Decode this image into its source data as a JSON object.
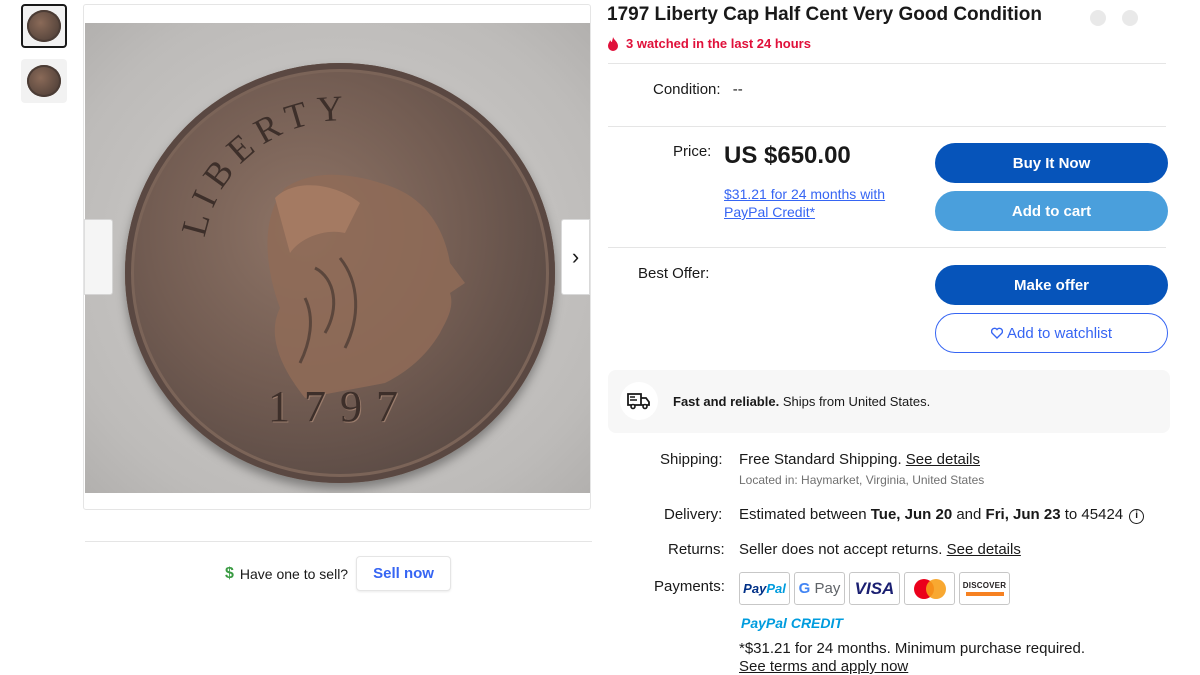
{
  "gallery": {
    "thumbnails": [
      "thumbnail-1",
      "thumbnail-2"
    ],
    "coin_legend": "LIBERTY",
    "coin_year": "1797",
    "prev_arrow": "chevron-left-icon",
    "next_arrow": "›"
  },
  "sell": {
    "prompt": "Have one to sell?",
    "button": "Sell now"
  },
  "listing": {
    "title": "1797 Liberty Cap Half Cent Very Good Condition",
    "watch_text": "3 watched in the last 24 hours",
    "condition_label": "Condition:",
    "condition_value": "--",
    "price_label": "Price:",
    "price_value": "US $650.00",
    "credit_offer": "$31.21 for 24 months with PayPal Credit*",
    "buy_now": "Buy It Now",
    "add_to_cart": "Add to cart",
    "best_offer_label": "Best Offer:",
    "make_offer": "Make offer",
    "add_to_watchlist": "Add to watchlist"
  },
  "shipping_banner": {
    "bold": "Fast and reliable.",
    "rest": " Ships from United States."
  },
  "details": {
    "shipping_label": "Shipping:",
    "shipping_value": "Free Standard Shipping.",
    "shipping_link": "See details",
    "location": "Located in: Haymarket, Virginia, United States",
    "delivery_label": "Delivery:",
    "delivery_pre": "Estimated between",
    "delivery_start": "Tue, Jun 20",
    "delivery_and": "and",
    "delivery_end": "Fri, Jun 23",
    "delivery_zip": "to 45424",
    "returns_label": "Returns:",
    "returns_value": "Seller does not accept returns.",
    "returns_link": "See details",
    "payments_label": "Payments:",
    "payment_methods": [
      "PayPal",
      "G Pay",
      "VISA",
      "Mastercard",
      "DISCOVER"
    ],
    "paypal_credit_pay": "Pay",
    "paypal_credit_pal": "Pal",
    "paypal_credit_word": " CREDIT",
    "credit_terms": "*$31.21 for 24 months. Minimum purchase required.",
    "terms_link": "See terms and apply now"
  },
  "colors": {
    "primary_blue": "#0654ba",
    "secondary_blue": "#4a9fdc",
    "link_blue": "#3665f3",
    "alert_red": "#e0103a"
  }
}
